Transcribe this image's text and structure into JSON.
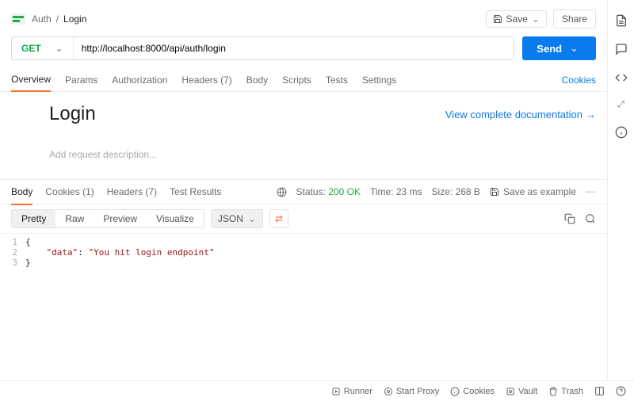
{
  "breadcrumbs": {
    "collection": "Auth",
    "request": "Login"
  },
  "topActions": {
    "save": "Save",
    "share": "Share"
  },
  "method": "GET",
  "url": "http://localhost:8000/api/auth/login",
  "send": "Send",
  "requestTabs": {
    "overview": "Overview",
    "params": "Params",
    "authorization": "Authorization",
    "headers": "Headers (7)",
    "body": "Body",
    "scripts": "Scripts",
    "tests": "Tests",
    "settings": "Settings",
    "cookies": "Cookies"
  },
  "overview": {
    "title": "Login",
    "docLink": "View complete documentation",
    "descPlaceholder": "Add request description..."
  },
  "responseTabs": {
    "body": "Body",
    "cookies": "Cookies (1)",
    "headers": "Headers (7)",
    "testResults": "Test Results"
  },
  "responseMeta": {
    "statusLabel": "Status:",
    "statusValue": "200 OK",
    "timeLabel": "Time:",
    "timeValue": "23 ms",
    "sizeLabel": "Size:",
    "sizeValue": "268 B",
    "saveAsExample": "Save as example"
  },
  "viewModes": {
    "pretty": "Pretty",
    "raw": "Raw",
    "preview": "Preview",
    "visualize": "Visualize",
    "format": "JSON"
  },
  "responseBody": {
    "l1": "{",
    "l2_key": "\"data\"",
    "l2_sep": ": ",
    "l2_val": "\"You hit login endpoint\"",
    "l3": "}"
  },
  "footer": {
    "runner": "Runner",
    "startProxy": "Start Proxy",
    "cookies": "Cookies",
    "vault": "Vault",
    "trash": "Trash"
  }
}
